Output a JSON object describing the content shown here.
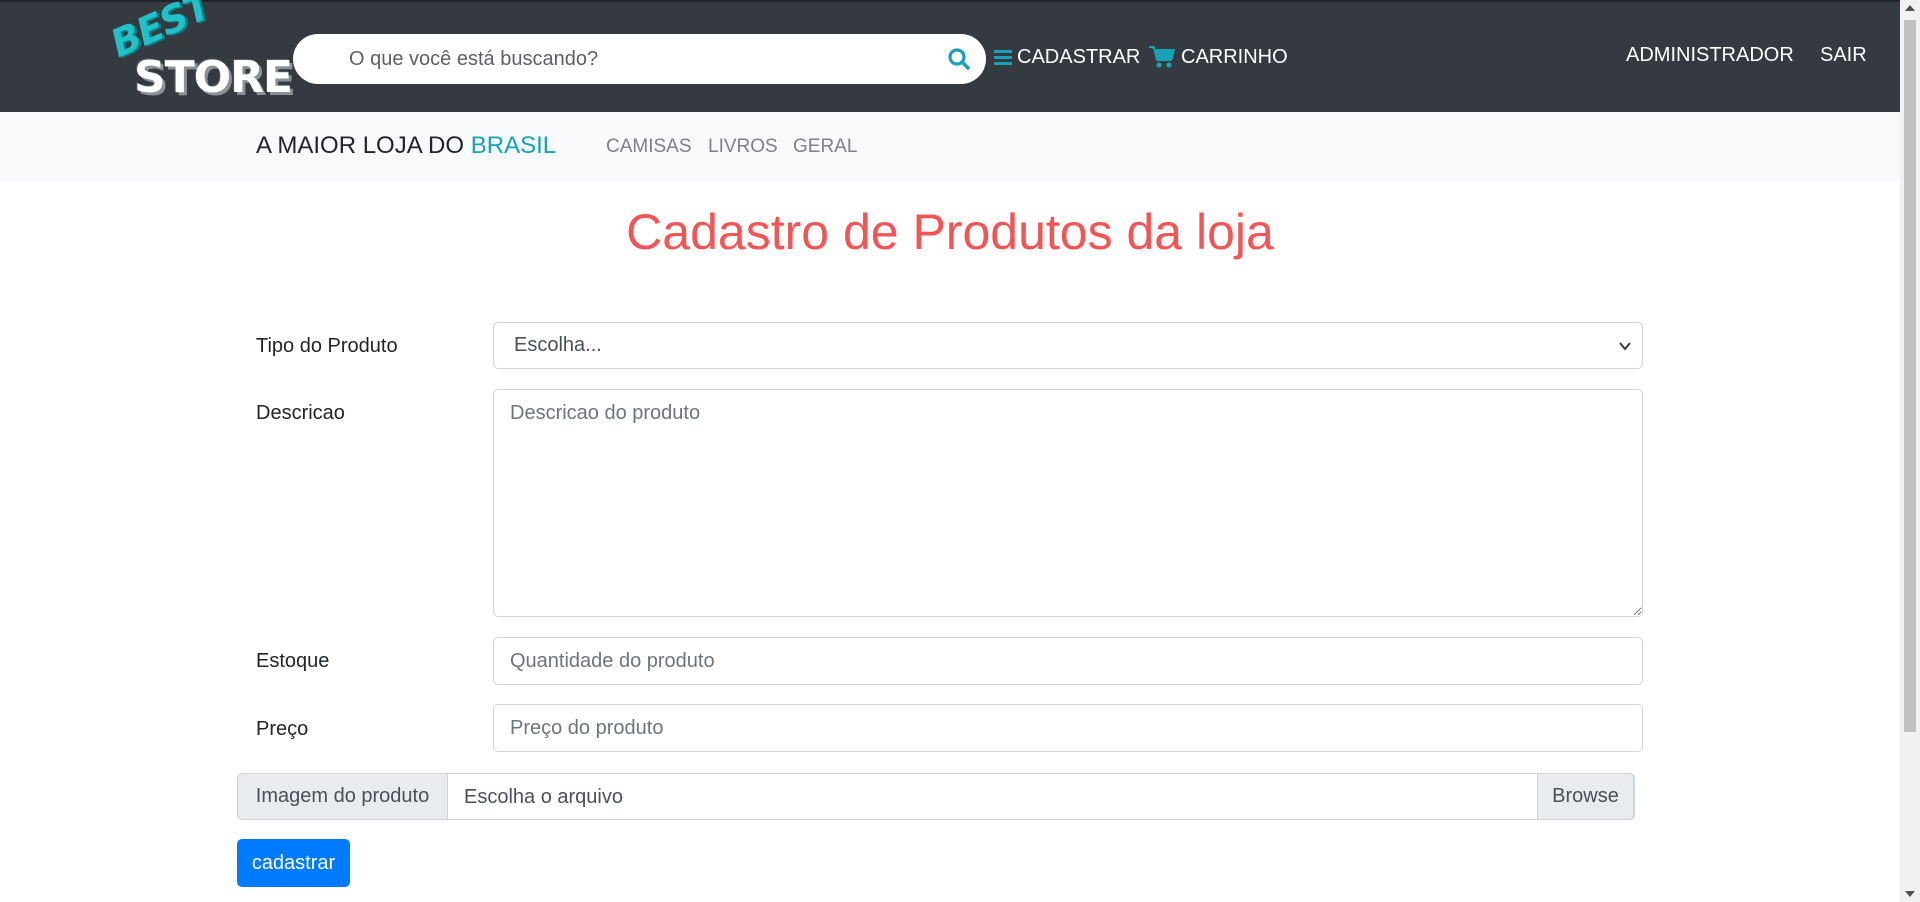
{
  "header": {
    "logo": {
      "top_text": "BEST",
      "bottom_text": "STORE"
    },
    "search": {
      "placeholder": "O que você está buscando?",
      "icon": "search-icon"
    },
    "nav": {
      "cadastrar": {
        "label": "CADASTRAR",
        "icon": "menu-icon"
      },
      "carrinho": {
        "label": "CARRINHO",
        "icon": "cart-icon"
      },
      "admin": {
        "label": "ADMINISTRADOR"
      },
      "sair": {
        "label": "SAIR"
      }
    }
  },
  "subnav": {
    "brand_prefix": "A MAIOR LOJA DO ",
    "brand_accent": "BRASIL",
    "links": [
      "CAMISAS",
      "LIVROS",
      "GERAL"
    ]
  },
  "page": {
    "title": "Cadastro de Produtos da loja"
  },
  "form": {
    "tipo": {
      "label": "Tipo do Produto",
      "selected": "Escolha..."
    },
    "descricao": {
      "label": "Descricao",
      "placeholder": "Descricao do produto"
    },
    "estoque": {
      "label": "Estoque",
      "placeholder": "Quantidade do produto"
    },
    "preco": {
      "label": "Preço",
      "placeholder": "Preço do produto"
    },
    "imagem": {
      "prepend": "Imagem do produto",
      "file_label": "Escolha o arquivo",
      "browse": "Browse"
    },
    "submit_label": "cadastrar"
  },
  "colors": {
    "header_bg": "#343a40",
    "subnav_bg": "#f8f9fa",
    "accent": "#17a2b8",
    "title": "#f55454",
    "primary": "#007bff"
  }
}
